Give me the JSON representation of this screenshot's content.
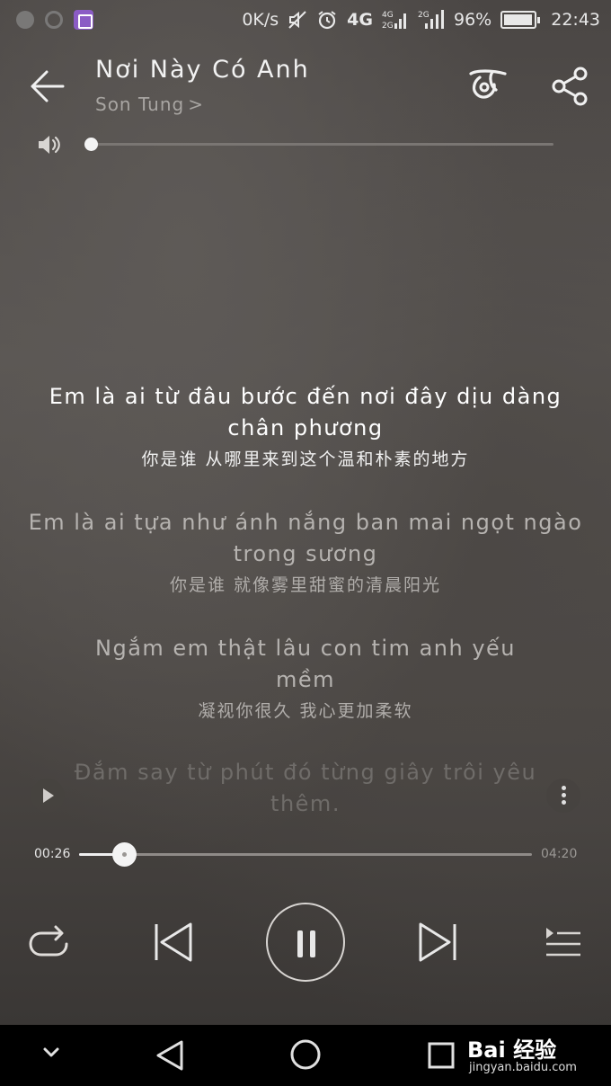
{
  "status_bar": {
    "net_speed": "0K/s",
    "signal_4g": "4G",
    "signal_4g2g": "4G 2G",
    "signal_2g": "2G",
    "battery": "96%",
    "time": "22:43"
  },
  "header": {
    "title": "Nơi Này Có Anh",
    "artist": "Son Tung",
    "artist_chevron": ">"
  },
  "volume": {
    "level": 0.0
  },
  "lyrics": [
    {
      "vi": "Em là ai từ đâu bước đến nơi đây dịu dàng chân phương",
      "zh": "你是谁 从哪里来到这个温和朴素的地方",
      "state": "current"
    },
    {
      "vi": "Em là ai tựa như ánh nắng ban mai ngọt ngào trong sương",
      "zh": "你是谁 就像雾里甜蜜的清晨阳光",
      "state": "next"
    },
    {
      "vi": "Ngắm em thật lâu con tim anh yếu mềm",
      "zh": "凝视你很久 我心更加柔软",
      "state": "next"
    },
    {
      "vi": "Đắm say từ phút đó từng giây trôi yêu thêm.",
      "zh": "",
      "state": "fade"
    }
  ],
  "progress": {
    "current": "00:26",
    "total": "04:20",
    "fraction": 0.1
  },
  "watermark": {
    "logo": "Bai ༀ经验",
    "logo_text": "Bai 经验",
    "url": "jingyan.baidu.com"
  },
  "icons": {
    "back": "arrow-left-icon",
    "effects": "sound-effects-icon",
    "share": "share-icon",
    "volume": "speaker-icon",
    "repeat": "repeat-icon",
    "prev": "skip-previous-icon",
    "pause": "pause-icon",
    "next": "skip-next-icon",
    "playlist": "playlist-icon"
  }
}
